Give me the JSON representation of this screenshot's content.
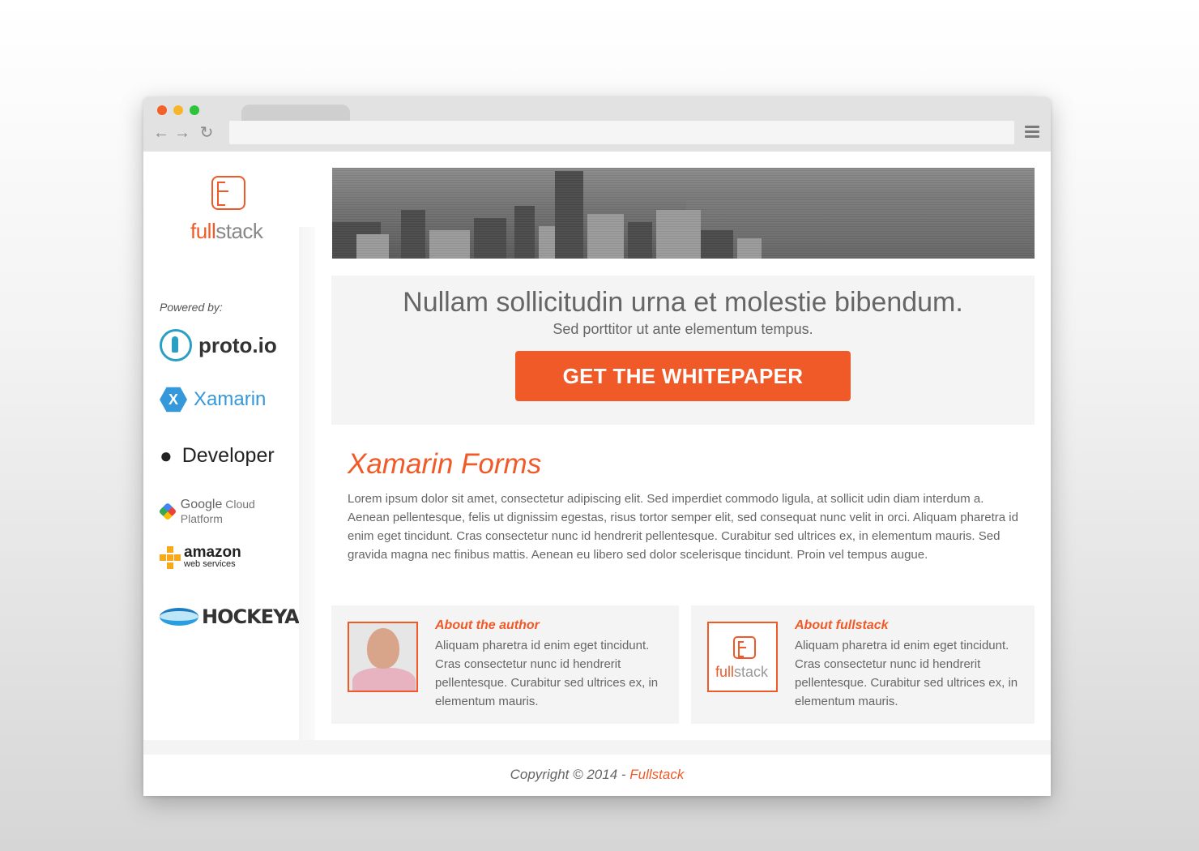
{
  "browser": {
    "nav_back": "←",
    "nav_forward": "→",
    "nav_reload": "↻",
    "url": ""
  },
  "brand": {
    "name_full": "full",
    "name_stack": "stack",
    "accent_color": "#f05a28"
  },
  "sidebar": {
    "powered_label": "Powered by:",
    "sponsors": [
      {
        "id": "proto",
        "icon": "rocket-icon",
        "label": "proto.io"
      },
      {
        "id": "xamarin",
        "icon": "xamarin-icon",
        "label": "Xamarin"
      },
      {
        "id": "apple",
        "icon": "apple-icon",
        "label": "Developer"
      },
      {
        "id": "google",
        "icon": "google-cloud-icon",
        "label_brand": "Google",
        "label": "Cloud Platform"
      },
      {
        "id": "amazon",
        "icon": "aws-icon",
        "label_brand": "amazon",
        "label": "web services"
      },
      {
        "id": "hockey",
        "icon": "hockeyapp-icon",
        "label": "HOCKEYAPP"
      }
    ]
  },
  "cta": {
    "title": "Nullam sollicitudin urna et molestie bibendum.",
    "subtitle": "Sed porttitor ut ante elementum tempus.",
    "button": "GET  THE WHITEPAPER"
  },
  "article": {
    "title": "Xamarin Forms",
    "body": "Lorem ipsum dolor sit amet, consectetur adipiscing elit. Sed imperdiet commodo ligula, at sollicit udin diam interdum a. Aenean pellentesque, felis ut dignissim egestas, risus tortor semper elit, sed consequat nunc velit in orci. Aliquam pharetra id enim eget tincidunt. Cras consectetur nunc id hendrerit pellentesque. Curabitur sed ultrices ex, in elementum mauris. Sed gravida magna nec finibus mattis. Aenean eu libero sed dolor scelerisque tincidunt. Proin vel tempus augue."
  },
  "cards": {
    "author": {
      "heading": "About the author",
      "body": "Aliquam pharetra id enim eget tincidunt. Cras consectetur nunc id hendrerit pellentesque. Curabitur sed ultrices ex, in elementum mauris."
    },
    "fullstack": {
      "heading": "About fullstack",
      "body": "Aliquam pharetra id enim eget tincidunt. Cras consectetur nunc id hendrerit pellentesque. Curabitur sed ultrices ex, in elementum mauris."
    }
  },
  "footer": {
    "copyright": "Copyright © 2014 - ",
    "link": "Fullstack"
  }
}
